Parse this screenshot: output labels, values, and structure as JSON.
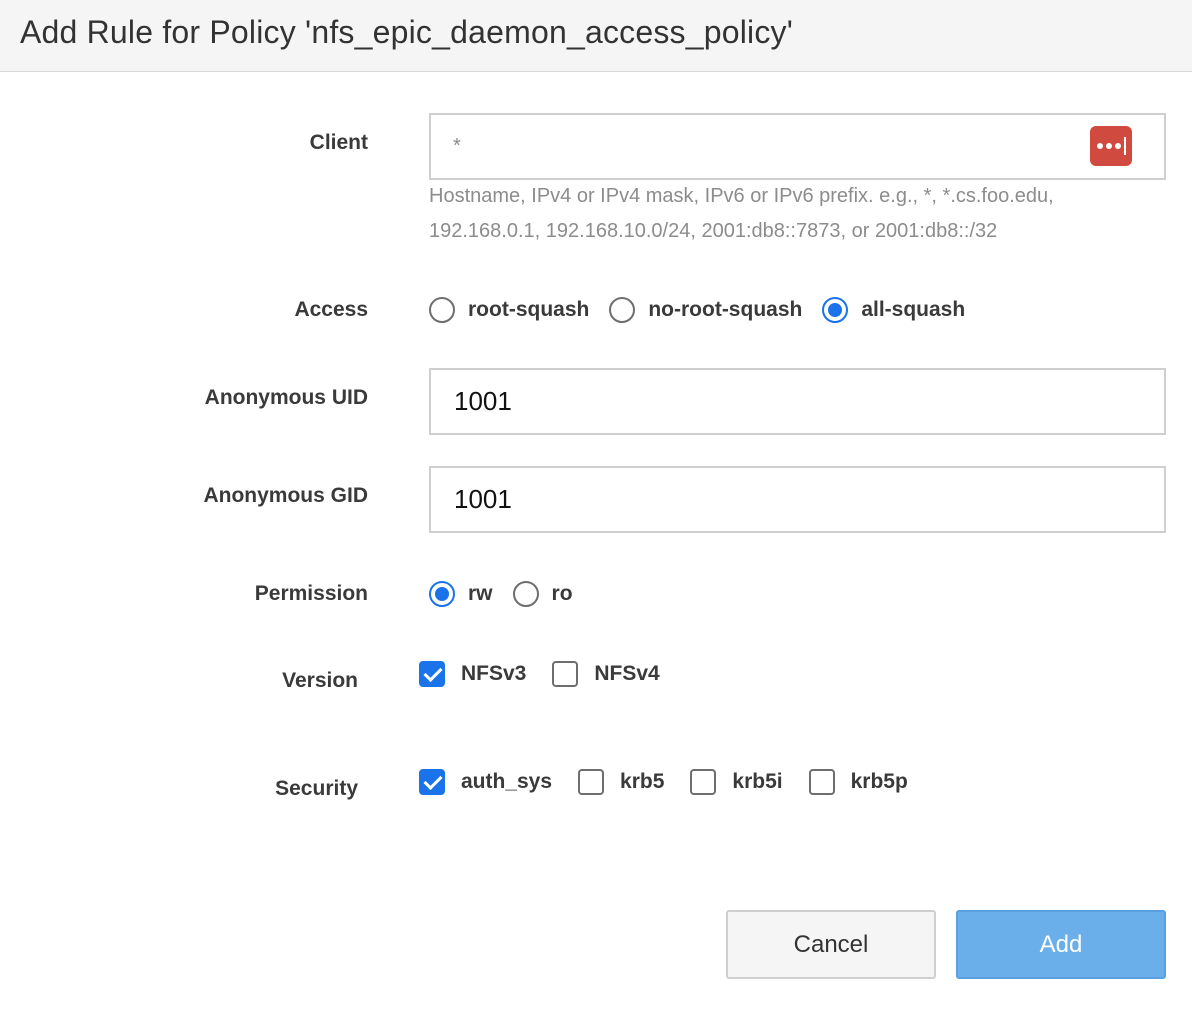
{
  "dialog": {
    "title": "Add Rule for Policy 'nfs_epic_daemon_access_policy'"
  },
  "client": {
    "label": "Client",
    "value": "",
    "placeholder": "*",
    "password_manager_icon": "lastpass-icon",
    "hint_line1": "Hostname, IPv4 or IPv4 mask, IPv6 or IPv6 prefix. e.g., *, *.cs.foo.edu,",
    "hint_line2": "192.168.0.1, 192.168.10.0/24, 2001:db8::7873, or 2001:db8::/32"
  },
  "access": {
    "label": "Access",
    "options": [
      {
        "label": "root-squash",
        "checked": false
      },
      {
        "label": "no-root-squash",
        "checked": false
      },
      {
        "label": "all-squash",
        "checked": true
      }
    ]
  },
  "anon_uid": {
    "label": "Anonymous UID",
    "value": "1001"
  },
  "anon_gid": {
    "label": "Anonymous GID",
    "value": "1001"
  },
  "permission": {
    "label": "Permission",
    "options": [
      {
        "label": "rw",
        "checked": true
      },
      {
        "label": "ro",
        "checked": false
      }
    ]
  },
  "version": {
    "label": "Version",
    "options": [
      {
        "label": "NFSv3",
        "checked": true
      },
      {
        "label": "NFSv4",
        "checked": false
      }
    ]
  },
  "security": {
    "label": "Security",
    "options": [
      {
        "label": "auth_sys",
        "checked": true
      },
      {
        "label": "krb5",
        "checked": false
      },
      {
        "label": "krb5i",
        "checked": false
      },
      {
        "label": "krb5p",
        "checked": false
      }
    ]
  },
  "buttons": {
    "cancel": "Cancel",
    "add": "Add"
  },
  "colors": {
    "accent": "#1a73e8",
    "add_button": "#6aaeea",
    "lastpass_red": "#d14a3f"
  }
}
